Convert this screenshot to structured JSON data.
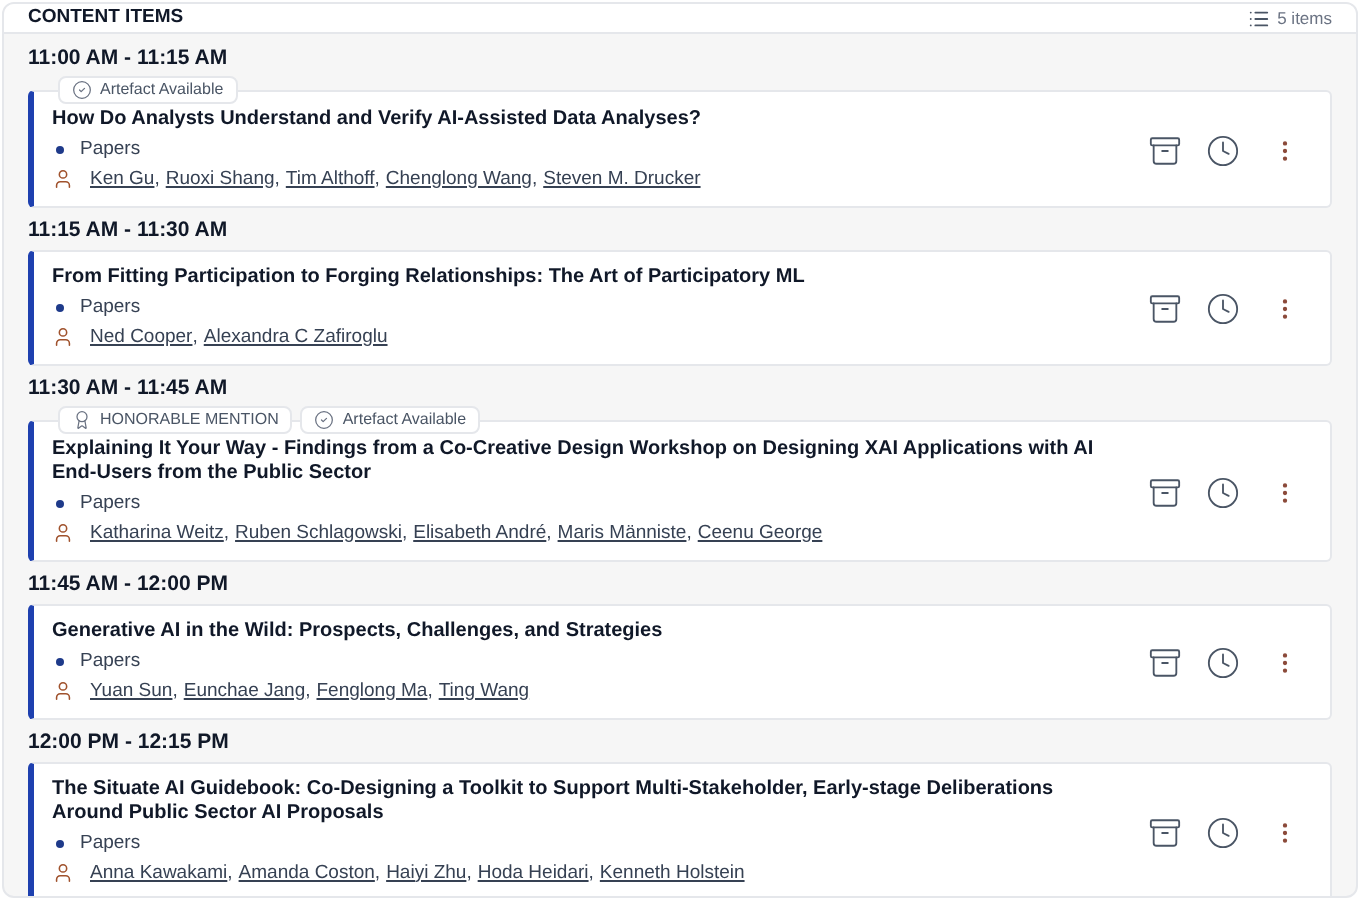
{
  "header": {
    "title": "CONTENT ITEMS",
    "count": "5 items"
  },
  "author_separator": ",",
  "sessions": [
    {
      "time": "11:00 AM - 11:15 AM",
      "badges": [
        {
          "kind": "artefact",
          "label": "Artefact Available"
        }
      ],
      "title": "How Do Analysts Understand and Verify AI-Assisted Data Analyses?",
      "category": "Papers",
      "authors": [
        "Ken Gu",
        "Ruoxi Shang",
        "Tim Althoff",
        "Chenglong Wang",
        "Steven M. Drucker"
      ]
    },
    {
      "time": "11:15 AM - 11:30 AM",
      "title": "From Fitting Participation to Forging Relationships: The Art of Participatory ML",
      "category": "Papers",
      "authors": [
        "Ned Cooper",
        "Alexandra C Zafiroglu"
      ]
    },
    {
      "time": "11:30 AM - 11:45 AM",
      "badges": [
        {
          "kind": "award",
          "label": "HONORABLE MENTION"
        },
        {
          "kind": "artefact",
          "label": "Artefact Available"
        }
      ],
      "title": "Explaining It Your Way - Findings from a Co-Creative Design Workshop on Designing XAI Applications with AI End-Users from the Public Sector",
      "category": "Papers",
      "authors": [
        "Katharina Weitz",
        "Ruben Schlagowski",
        "Elisabeth André",
        "Maris Männiste",
        "Ceenu George"
      ]
    },
    {
      "time": "11:45 AM - 12:00 PM",
      "title": "Generative AI in the Wild: Prospects, Challenges, and Strategies",
      "category": "Papers",
      "authors": [
        "Yuan Sun",
        "Eunchae Jang",
        "Fenglong Ma",
        "Ting Wang"
      ]
    },
    {
      "time": "12:00 PM - 12:15 PM",
      "title": "The Situate AI Guidebook: Co-Designing a Toolkit to Support Multi-Stakeholder, Early-stage Deliberations Around Public Sector AI Proposals",
      "category": "Papers",
      "authors": [
        "Anna Kawakami",
        "Amanda Coston",
        "Haiyi Zhu",
        "Hoda Heidari",
        "Kenneth Holstein"
      ]
    }
  ]
}
